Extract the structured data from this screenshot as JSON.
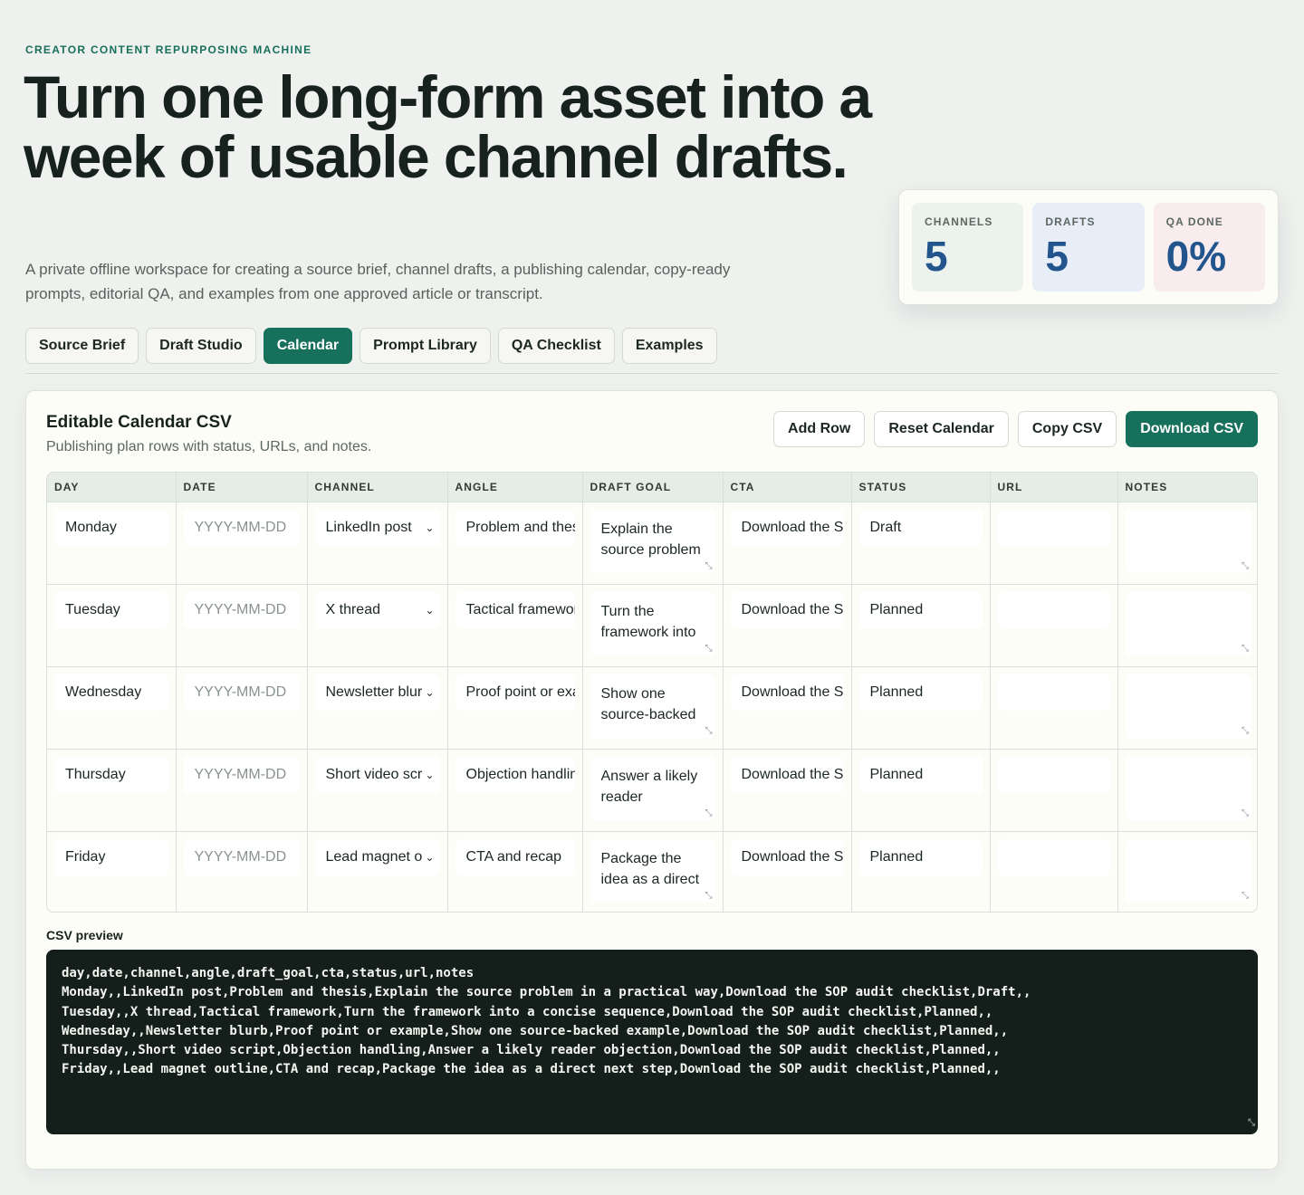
{
  "eyebrow": "CREATOR CONTENT REPURPOSING MACHINE",
  "hero": {
    "title": "Turn one long-form asset into a week of usable channel drafts.",
    "subtitle": "A private offline workspace for creating a source brief, channel drafts, a publishing calendar, copy-ready prompts, editorial QA, and examples from one approved article or transcript."
  },
  "stats": [
    {
      "label": "CHANNELS",
      "value": "5",
      "bg": "#ecf3ef"
    },
    {
      "label": "DRAFTS",
      "value": "5",
      "bg": "#e8eef7"
    },
    {
      "label": "QA DONE",
      "value": "0%",
      "bg": "#f8ecee"
    }
  ],
  "tabs": [
    {
      "label": "Source Brief",
      "active": false
    },
    {
      "label": "Draft Studio",
      "active": false
    },
    {
      "label": "Calendar",
      "active": true
    },
    {
      "label": "Prompt Library",
      "active": false
    },
    {
      "label": "QA Checklist",
      "active": false
    },
    {
      "label": "Examples",
      "active": false
    }
  ],
  "panel": {
    "title": "Editable Calendar CSV",
    "subtitle": "Publishing plan rows with status, URLs, and notes.",
    "actions": {
      "add_row": "Add Row",
      "reset": "Reset Calendar",
      "copy": "Copy CSV",
      "download": "Download CSV"
    }
  },
  "table": {
    "headers": [
      "DAY",
      "DATE",
      "CHANNEL",
      "ANGLE",
      "DRAFT GOAL",
      "CTA",
      "STATUS",
      "URL",
      "NOTES"
    ],
    "date_placeholder": "YYYY-MM-DD",
    "rows": [
      {
        "day": "Monday",
        "date": "",
        "channel": "LinkedIn post",
        "angle": "Problem and thesis",
        "goal": "Explain the source problem in a practical way",
        "cta": "Download the SOP audit checklist",
        "status": "Draft",
        "url": "",
        "notes": ""
      },
      {
        "day": "Tuesday",
        "date": "",
        "channel": "X thread",
        "angle": "Tactical framework",
        "goal": "Turn the framework into a concise sequence",
        "cta": "Download the SOP audit checklist",
        "status": "Planned",
        "url": "",
        "notes": ""
      },
      {
        "day": "Wednesday",
        "date": "",
        "channel": "Newsletter blurb",
        "angle": "Proof point or example",
        "goal": "Show one source-backed example",
        "cta": "Download the SOP audit checklist",
        "status": "Planned",
        "url": "",
        "notes": ""
      },
      {
        "day": "Thursday",
        "date": "",
        "channel": "Short video script",
        "angle": "Objection handling",
        "goal": "Answer a likely reader objection",
        "cta": "Download the SOP audit checklist",
        "status": "Planned",
        "url": "",
        "notes": ""
      },
      {
        "day": "Friday",
        "date": "",
        "channel": "Lead magnet outline",
        "angle": "CTA and recap",
        "goal": "Package the idea as a direct next step",
        "cta": "Download the SOP audit checklist",
        "status": "Planned",
        "url": "",
        "notes": ""
      }
    ]
  },
  "csv": {
    "label": "CSV preview",
    "text": "day,date,channel,angle,draft_goal,cta,status,url,notes\nMonday,,LinkedIn post,Problem and thesis,Explain the source problem in a practical way,Download the SOP audit checklist,Draft,,\nTuesday,,X thread,Tactical framework,Turn the framework into a concise sequence,Download the SOP audit checklist,Planned,,\nWednesday,,Newsletter blurb,Proof point or example,Show one source-backed example,Download the SOP audit checklist,Planned,,\nThursday,,Short video script,Objection handling,Answer a likely reader objection,Download the SOP audit checklist,Planned,,\nFriday,,Lead magnet outline,CTA and recap,Package the idea as a direct next step,Download the SOP audit checklist,Planned,,"
  },
  "icons": {
    "select_chevron": "chevron-down-icon",
    "resize_grip": "resize-grip-icon"
  }
}
